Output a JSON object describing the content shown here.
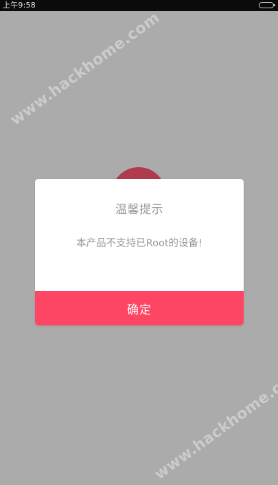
{
  "status_bar": {
    "time": "上午9:58"
  },
  "watermarks": {
    "top": "www.hackhome.com",
    "bottom": "www.hackhome.com"
  },
  "dialog": {
    "title": "温馨提示",
    "message": "本产品不支持已Root的设备!",
    "confirm_label": "确定"
  },
  "colors": {
    "accent": "#fe4563",
    "overlay": "#ababab",
    "background_circle": "#b03a4e"
  },
  "icons": {
    "battery": "battery-icon"
  }
}
